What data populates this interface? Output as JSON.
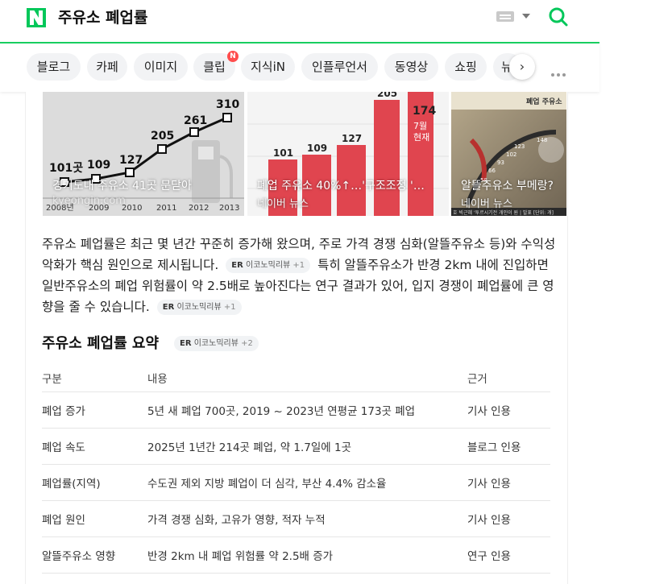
{
  "header": {
    "query": "주유소 폐업률",
    "logo_letter": "N"
  },
  "tabs": [
    {
      "label": "블로그"
    },
    {
      "label": "카페"
    },
    {
      "label": "이미지"
    },
    {
      "label": "클립",
      "badge": "N"
    },
    {
      "label": "지식iN"
    },
    {
      "label": "인플루언서"
    },
    {
      "label": "동영상"
    },
    {
      "label": "쇼핑"
    },
    {
      "label": "뉴"
    }
  ],
  "images": [
    {
      "caption": "경기도내 주유소 41곳 문닫아",
      "source": "kyeongin.com",
      "chart": {
        "years": [
          "2008년",
          "2009",
          "2010",
          "2011",
          "2012",
          "2013"
        ],
        "values": [
          "101곳",
          "109",
          "127",
          "205",
          "261",
          "310"
        ]
      }
    },
    {
      "caption": "폐업 주유소 40%↑…'구조조정 '…",
      "source": "네이버 뉴스",
      "chart": {
        "values": [
          "101",
          "109",
          "127",
          "205",
          "174"
        ],
        "note1": "7월",
        "note2": "현재"
      }
    },
    {
      "caption": "알뜰주유소 부메랑?",
      "source": "네이버 뉴스",
      "banner": "폐업 주유소",
      "nums": [
        "58",
        "66",
        "93",
        "102",
        "123",
        "148"
      ],
      "ticker": "호 빅근혜 '투르시기전 개인이 원 |  발표 [단위: 개]"
    }
  ],
  "paragraph": {
    "s1": "주유소 폐업률은 최근 몇 년간 꾸준히 증가해 왔으며, 주로 가격 경쟁 심화(알뜰주유소 등)와 수익성 악화가 핵심 원인으로 제시됩니다.",
    "s2": "특히 알뜰주유소가 반경 2km 내에 진입하면 일반주유소의 폐업 위험률이 약 2.5배로 높아진다는 연구 결과가 있어, 입지 경쟁이 폐업률에 큰 영향을 줄 수 있습니다.",
    "chip1_prefix": "ER",
    "chip1_label": "이코노믹리뷰",
    "chip1_count": "+1",
    "chip2_prefix": "ER",
    "chip2_label": "이코노믹리뷰",
    "chip2_count": "+1"
  },
  "summary": {
    "title": "주유소 폐업률 요약",
    "chip_prefix": "ER",
    "chip_label": "이코노믹리뷰",
    "chip_count": "+2",
    "headers": [
      "구분",
      "내용",
      "근거"
    ],
    "rows": [
      [
        "폐업 증가",
        "5년 새 폐업 700곳, 2019 ~ 2023년 연평균 173곳 폐업",
        "기사 인용"
      ],
      [
        "폐업 속도",
        "2025년 1년간 214곳 폐업, 약 1.7일에 1곳",
        "블로그 인용"
      ],
      [
        "폐업률(지역)",
        "수도권 제외 지방 폐업이 더 심각, 부산 4.4% 감소율",
        "기사 인용"
      ],
      [
        "폐업 원인",
        "가격 경쟁 심화, 고유가 영향, 적자 누적",
        "기사 인용"
      ],
      [
        "알뜰주유소 영향",
        "반경 2km 내 폐업 위험률 약 2.5배 증가",
        "연구 인용"
      ]
    ]
  },
  "colors": {
    "naver_green": "#03c75a",
    "accent_line": "#19ce60",
    "badge_red": "#ff4d4d",
    "bar_red": "#e0454f"
  }
}
